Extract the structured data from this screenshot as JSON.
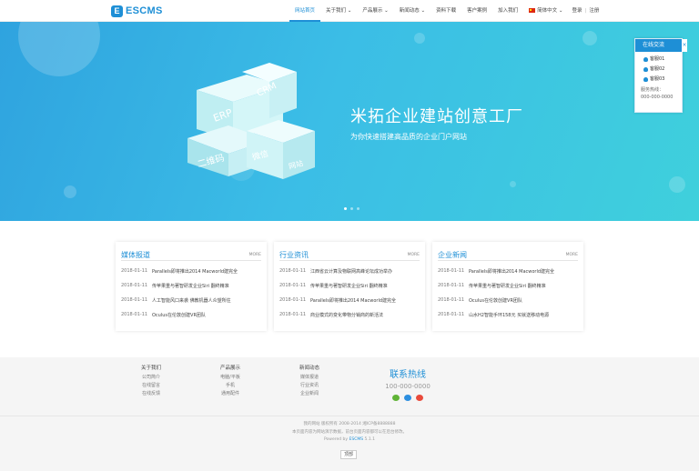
{
  "header": {
    "logo_text": "ESCMS",
    "logo_mark": "E",
    "nav": [
      {
        "label": "网站首页",
        "active": true
      },
      {
        "label": "关于我们 ⌄",
        "active": false
      },
      {
        "label": "产品展示 ⌄",
        "active": false
      },
      {
        "label": "新闻动态 ⌄",
        "active": false
      },
      {
        "label": "资料下载",
        "active": false
      },
      {
        "label": "客户案例",
        "active": false
      },
      {
        "label": "加入我们",
        "active": false
      }
    ],
    "language": "简体中文 ⌄",
    "login": "登录",
    "separator": "|",
    "register": "注册"
  },
  "banner": {
    "title": "米拓企业建站创意工厂",
    "subtitle": "为你快速搭建高品质的企业门户网站",
    "cube_labels": [
      "ERP",
      "CRM",
      "二维码",
      "微信",
      "网站"
    ],
    "slide_count": 3,
    "active_slide": 1
  },
  "chat": {
    "title": "在线交流",
    "close": "×",
    "agents": [
      "客服01",
      "客服02",
      "客服03"
    ],
    "hotline_label": "服务热线：",
    "hotline": "000-000-0000"
  },
  "cards": [
    {
      "title": "媒体报道",
      "more": "MORE",
      "items": [
        {
          "date": "2018-01-11",
          "title": "Parallels即将推出2014 Macworld建完全"
        },
        {
          "date": "2018-01-11",
          "title": "传苹果重与著智研发企业Siri 翻终精准"
        },
        {
          "date": "2018-01-11",
          "title": "人工智能风口来袭 佛教机器人众望所往"
        },
        {
          "date": "2018-01-11",
          "title": "Oculus在伦敦创建VR团队"
        }
      ]
    },
    {
      "title": "行业资讯",
      "more": "MORE",
      "items": [
        {
          "date": "2018-01-11",
          "title": "江西省云计算及物联网高峰论坛成功举办"
        },
        {
          "date": "2018-01-11",
          "title": "传苹果重与著智研发企业Siri 翻终精准"
        },
        {
          "date": "2018-01-11",
          "title": "Parallels即将推出2014 Macworld建完全"
        },
        {
          "date": "2018-01-11",
          "title": "商业模式的变化带物分销商的新活法"
        }
      ]
    },
    {
      "title": "企业新闻",
      "more": "MORE",
      "items": [
        {
          "date": "2018-01-11",
          "title": "Parallels即将推出2014 Macworld建完全"
        },
        {
          "date": "2018-01-11",
          "title": "传苹果重与著智研发企业Siri 翻终精准"
        },
        {
          "date": "2018-01-11",
          "title": "Oculus在伦敦创建VR团队"
        },
        {
          "date": "2018-01-11",
          "title": "山水H2智能手环158元 买就送移动电源"
        }
      ]
    }
  ],
  "footer": {
    "columns": [
      {
        "title": "关于我们",
        "links": [
          "公司简介",
          "在线留言",
          "在线反馈"
        ]
      },
      {
        "title": "产品展示",
        "links": [
          "电脑/平板",
          "手机",
          "通用配件"
        ]
      },
      {
        "title": "新闻动态",
        "links": [
          "媒体报道",
          "行业资讯",
          "企业新闻"
        ]
      }
    ],
    "hotline_title": "联系热线",
    "hotline_number": "100-000-0000",
    "social_icons": [
      "wechat-icon",
      "qq-icon",
      "weibo-icon"
    ],
    "copyright": "我的网站 版权所有 2008-2014 湘ICP备8888888",
    "notice": "本页面内容为网站演示数据，前台页面内容都可以在后台修改。",
    "powered_prefix": "Powered by",
    "powered_brand": "ESCMS",
    "powered_version": "5.1.1",
    "totop": "顶部",
    "colors": {
      "accent": "#1e8fd6",
      "banner_start": "#2fa3df",
      "banner_end": "#3fd0dc"
    }
  }
}
